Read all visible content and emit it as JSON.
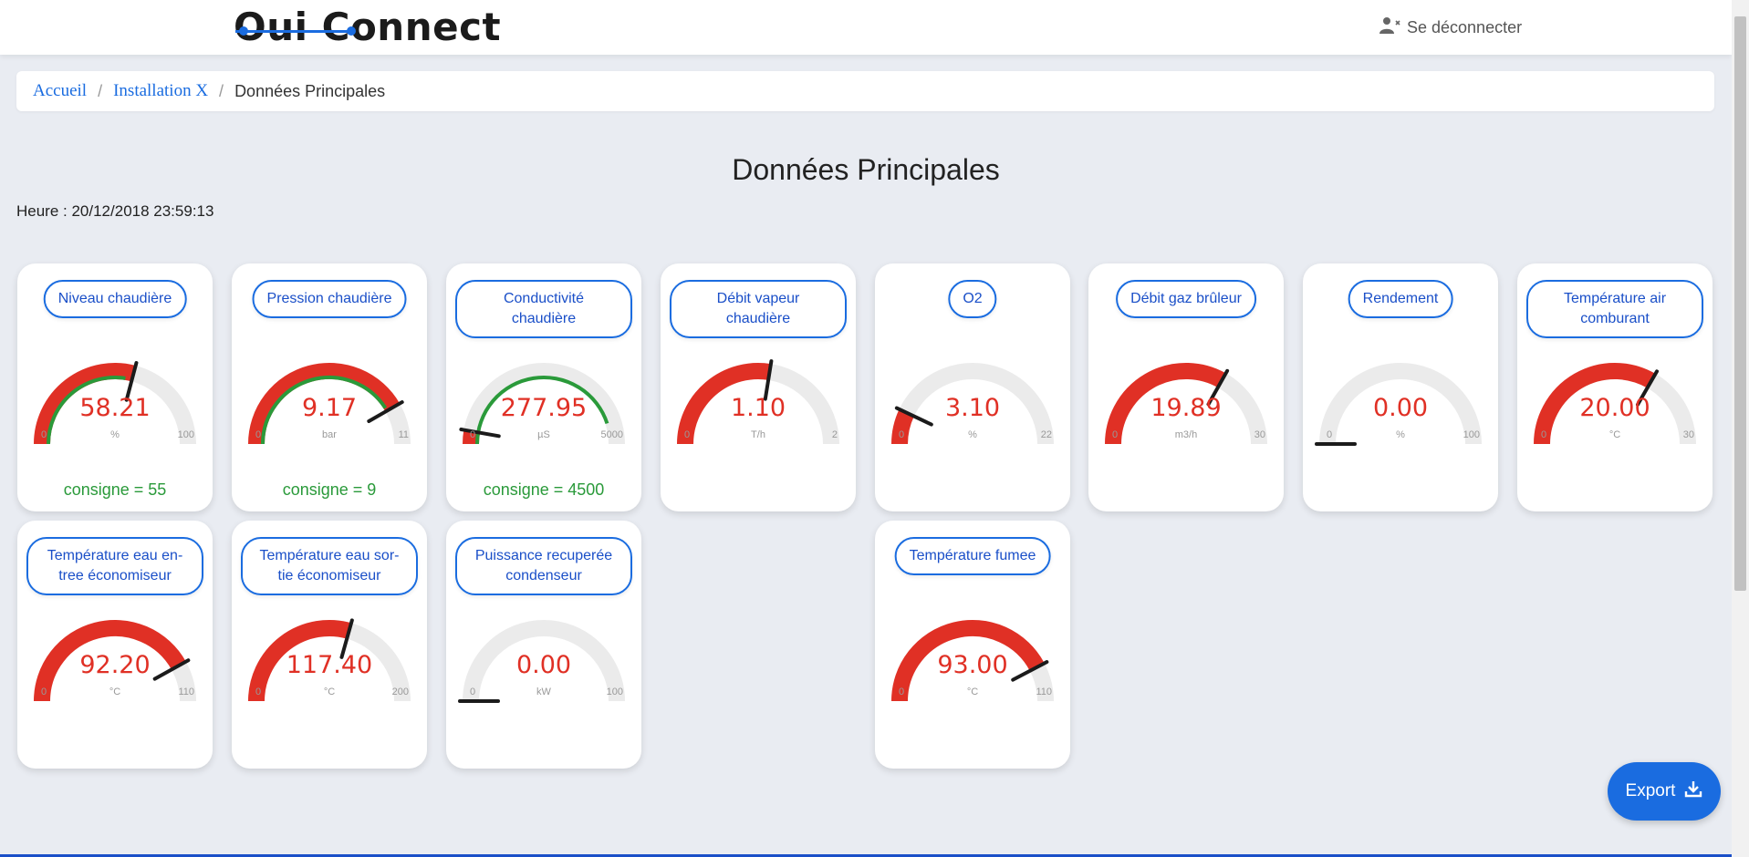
{
  "header": {
    "logo_text": "Oui Connect",
    "logout_label": "Se déconnecter"
  },
  "breadcrumb": {
    "items": [
      "Accueil",
      "Installation X"
    ],
    "current": "Données Principales"
  },
  "page": {
    "title": "Données Principales",
    "time_label": "Heure : 20/12/2018 23:59:13"
  },
  "colors": {
    "accent": "#1a6ce0",
    "value_red": "#e03025",
    "consigne_green": "#2a9a3a",
    "track_grey": "#ebebeb"
  },
  "gauges": [
    {
      "label": "Niveau chaudière",
      "value": "58.21",
      "value_num": 58.21,
      "unit": "%",
      "min": "0",
      "max": "100",
      "min_num": 0,
      "max_num": 100,
      "consigne": "consigne = 55",
      "consigne_num": 55
    },
    {
      "label": "Pression chaudière",
      "value": "9.17",
      "value_num": 9.17,
      "unit": "bar",
      "min": "0",
      "max": "11",
      "min_num": 0,
      "max_num": 11,
      "consigne": "consigne = 9",
      "consigne_num": 9
    },
    {
      "label": "Conductivité chaudière",
      "value": "277.95",
      "value_num": 277.95,
      "unit": "µS",
      "min": "0",
      "max": "5000",
      "min_num": 0,
      "max_num": 5000,
      "consigne": "consigne = 4500",
      "consigne_num": 4500
    },
    {
      "label": "Débit vapeur chaudière",
      "value": "1.10",
      "value_num": 1.1,
      "unit": "T/h",
      "min": "0",
      "max": "2",
      "min_num": 0,
      "max_num": 2
    },
    {
      "label": "O2",
      "value": "3.10",
      "value_num": 3.1,
      "unit": "%",
      "min": "0",
      "max": "22",
      "min_num": 0,
      "max_num": 22
    },
    {
      "label": "Débit gaz brûleur",
      "value": "19.89",
      "value_num": 19.89,
      "unit": "m3/h",
      "min": "0",
      "max": "30",
      "min_num": 0,
      "max_num": 30
    },
    {
      "label": "Rendement",
      "value": "0.00",
      "value_num": 0,
      "unit": "%",
      "min": "0",
      "max": "100",
      "min_num": 0,
      "max_num": 100
    },
    {
      "label": "Température air comburant",
      "value": "20.00",
      "value_num": 20,
      "unit": "°C",
      "min": "0",
      "max": "30",
      "min_num": 0,
      "max_num": 30
    },
    {
      "label": "Température eau en-tree économiseur",
      "value": "92.20",
      "value_num": 92.2,
      "unit": "°C",
      "min": "0",
      "max": "110",
      "min_num": 0,
      "max_num": 110
    },
    {
      "label": "Température eau sor-tie économiseur",
      "value": "117.40",
      "value_num": 117.4,
      "unit": "°C",
      "min": "0",
      "max": "200",
      "min_num": 0,
      "max_num": 200
    },
    {
      "label": "Puissance recuperée condenseur",
      "value": "0.00",
      "value_num": 0,
      "unit": "kW",
      "min": "0",
      "max": "100",
      "min_num": 0,
      "max_num": 100
    },
    {
      "label": "Température fumee",
      "value": "93.00",
      "value_num": 93,
      "unit": "°C",
      "min": "0",
      "max": "110",
      "min_num": 0,
      "max_num": 110
    }
  ],
  "export_label": "Export"
}
